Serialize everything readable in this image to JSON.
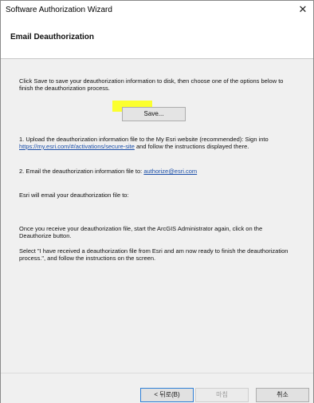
{
  "window": {
    "title": "Software Authorization Wizard",
    "close_glyph": "✕"
  },
  "header": {
    "title": "Email Deauthorization"
  },
  "content": {
    "intro": "Click Save to save your deauthorization information to disk, then choose one of the options below to finish the deauthorization process.",
    "save_label": "Save...",
    "step1_prefix": "1.  Upload the deauthorization information file to the My Esri website (recommended): Sign into",
    "step1_link": "https://my.esri.com/#/activations/secure-site",
    "step1_suffix": " and follow the instructions displayed there.",
    "step2_prefix": "2.  Email the deauthorization information file to: ",
    "step2_email": "authorize@esri.com",
    "esri_will_email": "Esri will email your deauthorization file to:",
    "once_receive": "Once you receive your deauthorization file, start the ArcGIS Administrator again, click on the Deauthorize button.",
    "select_instruction": "Select \"I have received a deauthorization file from Esri and am now ready to finish the deauthorization process.\", and follow the instructions on the screen."
  },
  "footer": {
    "back_label": "< 뒤로(B)",
    "finish_label": "마침",
    "cancel_label": "취소"
  },
  "colors": {
    "highlight": "#fbff2e",
    "link": "#1a4ea8"
  }
}
